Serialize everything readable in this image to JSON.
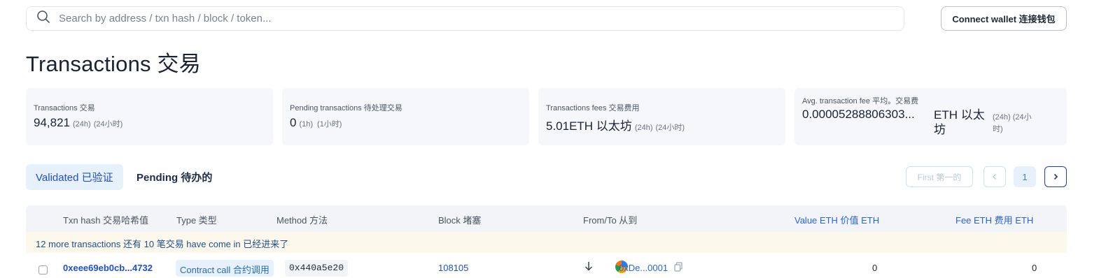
{
  "search": {
    "placeholder": "Search by address / txn hash / block / token..."
  },
  "header": {
    "connect_wallet": "Connect wallet 连接钱包"
  },
  "page": {
    "title": "Transactions 交易"
  },
  "stats": [
    {
      "label": "Transactions 交易",
      "value": "94,821",
      "sub1": "(24h)",
      "sub2": "(24小时)"
    },
    {
      "label": "Pending transactions 待处理交易",
      "value": "0",
      "sub1": "(1h)",
      "sub2": "(1小时)"
    },
    {
      "label": "Transactions fees 交易费用",
      "value": "5.01ETH 以太坊",
      "sub1": "(24h)",
      "sub2": "(24小时)"
    },
    {
      "label": "Avg. transaction fee 平均。交易费",
      "value": "0.00005288806303...",
      "unit": "ETH 以太坊",
      "sub": "(24h) (24小时)"
    }
  ],
  "tabs": [
    {
      "label": "Validated 已验证",
      "active": true
    },
    {
      "label": "Pending 待办的",
      "active": false
    }
  ],
  "pagination": {
    "first": "First 第一的",
    "prev": "‹",
    "page": "1",
    "next": "›"
  },
  "table": {
    "headers": {
      "txn_hash": "Txn hash 交易哈希值",
      "type": "Type 类型",
      "method": "Method 方法",
      "block": "Block 堵塞",
      "from_to": "From/To 从到",
      "value": "Value ETH 价值 ETH",
      "fee": "Fee ETH 费用 ETH"
    },
    "notice": "12 more transactions 还有 10 笔交易 have come in 已经进来了",
    "rows": [
      {
        "hash": "0xeee69eb0cb...4732",
        "type": "Contract call 合约调用",
        "method": "0x440a5e20",
        "block": "108105",
        "to": "0xDe...0001",
        "value": "0",
        "fee": "0"
      }
    ]
  },
  "colors": {
    "accent": "#1d4ed8",
    "card_bg": "#f5f7fa",
    "notice_bg": "#fdf8ec"
  }
}
